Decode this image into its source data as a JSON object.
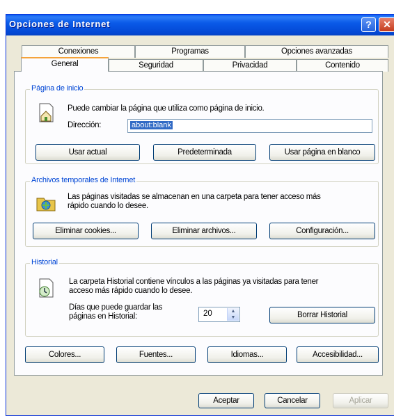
{
  "window": {
    "title": "Opciones de Internet",
    "help": "?",
    "close": "✕"
  },
  "tabs": {
    "row1": [
      "Conexiones",
      "Programas",
      "Opciones avanzadas"
    ],
    "row2": [
      "General",
      "Seguridad",
      "Privacidad",
      "Contenido"
    ],
    "active": "General"
  },
  "home": {
    "legend": "Página de inicio",
    "desc": "Puede cambiar la página que utiliza como página de inicio.",
    "address_label": "Dirección:",
    "address_value": "about:blank",
    "buttons": [
      "Usar actual",
      "Predeterminada",
      "Usar página en blanco"
    ]
  },
  "temp": {
    "legend": "Archivos temporales de Internet",
    "desc1": "Las páginas visitadas se almacenan en una carpeta para tener acceso más",
    "desc2": "rápido cuando lo desee.",
    "buttons": [
      "Eliminar cookies...",
      "Eliminar archivos...",
      "Configuración..."
    ]
  },
  "history": {
    "legend": "Historial",
    "desc1": "La carpeta Historial contiene vínculos a las páginas ya visitadas para tener",
    "desc2": "acceso más rápido cuando lo desee.",
    "days_label1": "Días que puede guardar las",
    "days_label2": "páginas en Historial:",
    "days_value": "20",
    "clear_button": "Borrar Historial"
  },
  "bottom_buttons": [
    "Colores...",
    "Fuentes...",
    "Idiomas...",
    "Accesibilidad..."
  ],
  "dialog_buttons": {
    "ok": "Aceptar",
    "cancel": "Cancelar",
    "apply": "Aplicar"
  }
}
